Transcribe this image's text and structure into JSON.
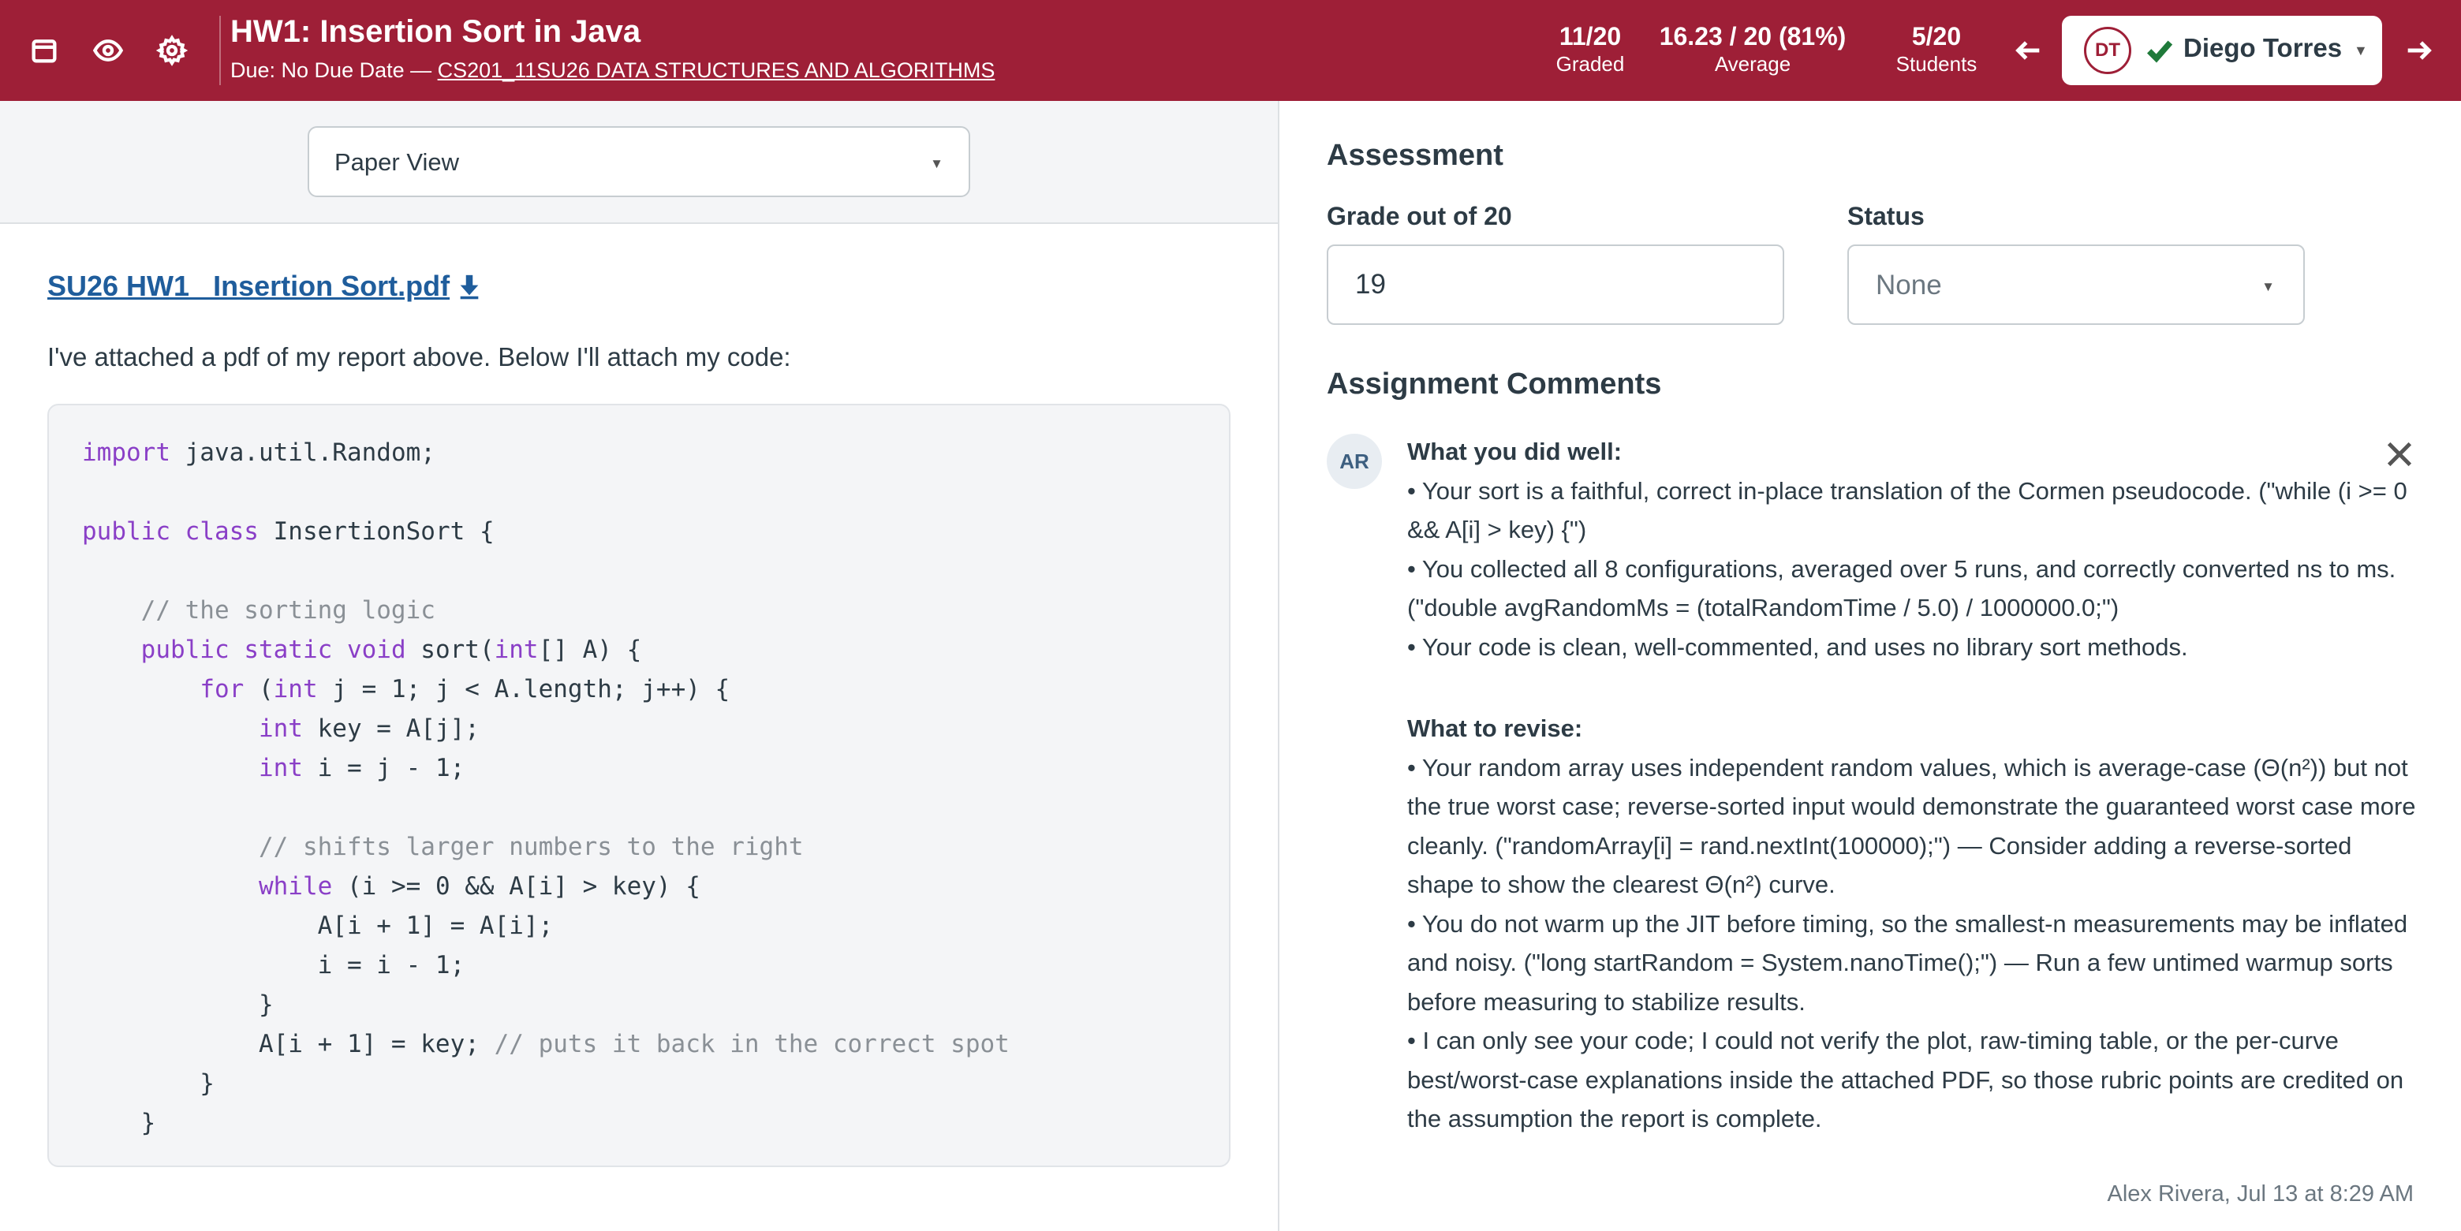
{
  "header": {
    "title": "HW1: Insertion Sort in Java",
    "due_prefix": "Due: No Due Date — ",
    "course": "CS201_11SU26 DATA STRUCTURES AND ALGORITHMS",
    "icons": [
      "calendar-icon",
      "eye-icon",
      "gear-icon"
    ],
    "stats": [
      {
        "value": "11/20",
        "label": "Graded"
      },
      {
        "value": "16.23 / 20 (81%)",
        "label": "Average"
      },
      {
        "value": "5/20",
        "label": "Students"
      }
    ],
    "student": {
      "initials": "DT",
      "name": "Diego Torres"
    },
    "accent_color": "#9e1f37"
  },
  "left": {
    "view_select": "Paper View",
    "file_link": "SU26 HW1_ Insertion Sort.pdf",
    "intro": "I've attached a pdf of my report above. Below I'll attach my code:",
    "code": [
      "import java.util.Random;",
      "",
      "public class InsertionSort {",
      "",
      "    // the sorting logic",
      "    public static void sort(int[] A) {",
      "        for (int j = 1; j < A.length; j++) {",
      "            int key = A[j];",
      "            int i = j - 1;",
      "",
      "            // shifts larger numbers to the right",
      "            while (i >= 0 && A[i] > key) {",
      "                A[i + 1] = A[i];",
      "                i = i - 1;",
      "            }",
      "            A[i + 1] = key; // puts it back in the correct spot",
      "        }",
      "    }"
    ]
  },
  "right": {
    "assessment_title": "Assessment",
    "grade_label": "Grade out of 20",
    "grade_value": "19",
    "status_label": "Status",
    "status_value": "None",
    "comments_title": "Assignment Comments",
    "comment": {
      "author_initials": "AR",
      "well_heading": "What you did well:",
      "well_items": [
        "• Your sort is a faithful, correct in-place translation of the Cormen pseudocode. (\"while (i >= 0 && A[i] > key) {\")",
        "• You collected all 8 configurations, averaged over 5 runs, and correctly converted ns to ms. (\"double avgRandomMs = (totalRandomTime / 5.0) / 1000000.0;\")",
        "• Your code is clean, well-commented, and uses no library sort methods."
      ],
      "revise_heading": "What to revise:",
      "revise_items": [
        "• Your random array uses independent random values, which is average-case (Θ(n²)) but not the true worst case; reverse-sorted input would demonstrate the guaranteed worst case more cleanly. (\"randomArray[i] = rand.nextInt(100000);\") — Consider adding a reverse-sorted shape to show the clearest Θ(n²) curve.",
        "• You do not warm up the JIT before timing, so the smallest-n measurements may be inflated and noisy. (\"long startRandom = System.nanoTime();\") — Run a few untimed warmup sorts before measuring to stabilize results.",
        "• I can only see your code; I could not verify the plot, raw-timing table, or the per-curve best/worst-case explanations inside the attached PDF, so those rubric points are credited on the assumption the report is complete."
      ],
      "meta": "Alex Rivera, Jul 13 at 8:29 AM"
    }
  }
}
